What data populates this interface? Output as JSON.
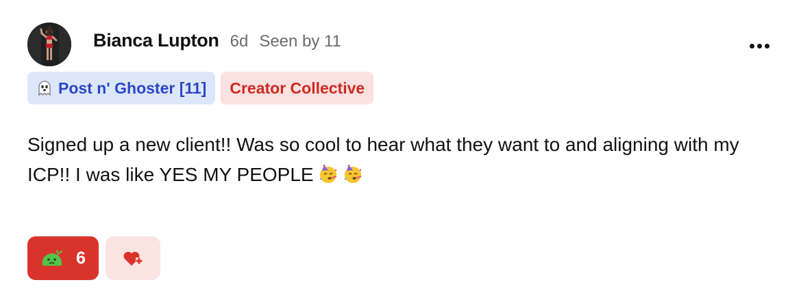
{
  "post": {
    "author": "Bianca Lupton",
    "time": "6d",
    "seen": "Seen by 11",
    "tags": [
      {
        "label": "Post n' Ghoster [11]",
        "icon": "ghost-icon",
        "color": "#2a46c7",
        "background": "#dde7fb"
      },
      {
        "label": "Creator Collective",
        "color": "#cc2a22",
        "background": "#fbe1e0"
      }
    ],
    "body": "Signed up a new client!! Was so cool to hear what they want to and aligning with my ICP!! I was like YES MY PEOPLE",
    "body_emoji": [
      "partying-face-icon",
      "partying-face-icon"
    ],
    "reactions": [
      {
        "icon": "green-blob-icon",
        "count": "6",
        "color": "#d9342b"
      }
    ],
    "add_reaction_icon": "heart-plus-icon",
    "menu_icon": "more-horizontal-icon"
  }
}
